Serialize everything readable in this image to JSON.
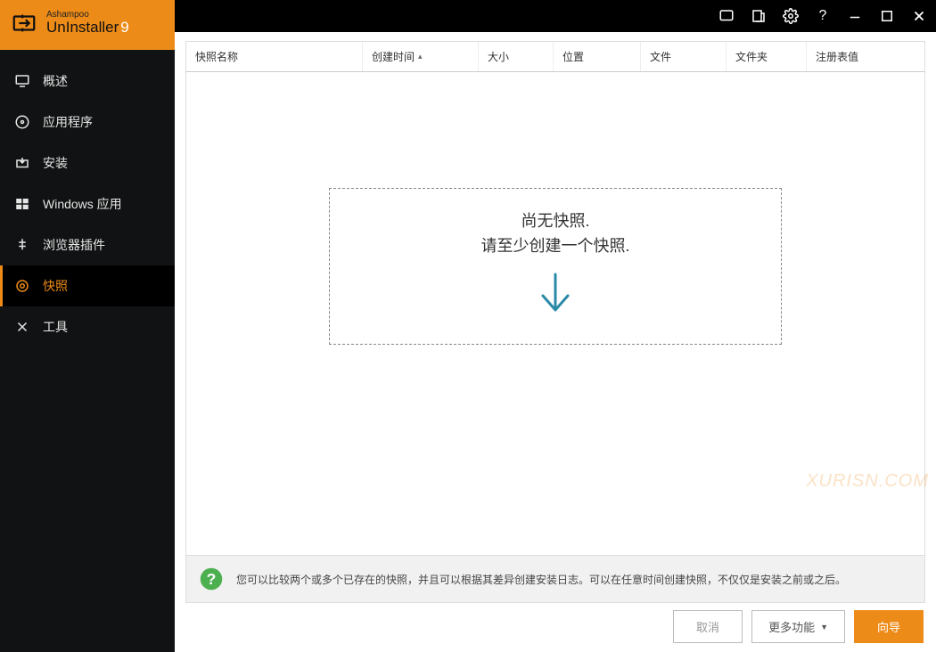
{
  "brand": {
    "small": "Ashampoo",
    "name": "UnInstaller",
    "version": "9"
  },
  "titlebar": {
    "feedback": "feedback",
    "news": "news",
    "settings": "settings",
    "help": "?",
    "minimize": "minimize",
    "maximize": "maximize",
    "close": "close"
  },
  "sidebar": {
    "items": [
      {
        "key": "overview",
        "label": "概述"
      },
      {
        "key": "applications",
        "label": "应用程序"
      },
      {
        "key": "install",
        "label": "安装"
      },
      {
        "key": "windows-apps",
        "label": "Windows 应用"
      },
      {
        "key": "browser-plugins",
        "label": "浏览器插件"
      },
      {
        "key": "snapshots",
        "label": "快照"
      },
      {
        "key": "tools",
        "label": "工具"
      }
    ],
    "active": "snapshots"
  },
  "table": {
    "columns": {
      "name": "快照名称",
      "time": "创建时间",
      "size": "大小",
      "location": "位置",
      "file": "文件",
      "folder": "文件夹",
      "registry": "注册表值"
    },
    "sort_indicator": "▴",
    "rows": []
  },
  "empty": {
    "line1": "尚无快照.",
    "line2": "请至少创建一个快照."
  },
  "info": {
    "text": "您可以比较两个或多个已存在的快照，并且可以根据其差异创建安装日志。可以在任意时间创建快照，不仅仅是安装之前或之后。"
  },
  "footer": {
    "cancel": "取消",
    "more": "更多功能",
    "wizard": "向导"
  },
  "watermark": "XURISN.COM"
}
